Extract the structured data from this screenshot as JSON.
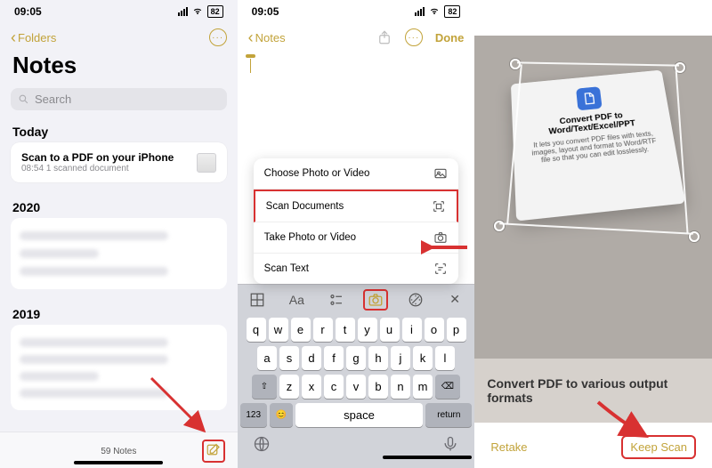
{
  "status": {
    "time": "09:05",
    "battery": "82"
  },
  "accent": "#c2a33a",
  "phone1": {
    "back_label": "Folders",
    "title": "Notes",
    "search_placeholder": "Search",
    "sections": {
      "today": "Today",
      "y2020": "2020",
      "y2019": "2019"
    },
    "note": {
      "title": "Scan to a PDF on your iPhone",
      "time": "08:54",
      "detail": "1 scanned document"
    },
    "footer_count": "59 Notes"
  },
  "phone2": {
    "back_label": "Notes",
    "done_label": "Done",
    "popup": [
      "Choose Photo or Video",
      "Scan Documents",
      "Take Photo or Video",
      "Scan Text"
    ],
    "toolbar": {
      "aa": "Aa"
    },
    "keyboard": {
      "row1": [
        "q",
        "w",
        "e",
        "r",
        "t",
        "y",
        "u",
        "i",
        "o",
        "p"
      ],
      "row2": [
        "a",
        "s",
        "d",
        "f",
        "g",
        "h",
        "j",
        "k",
        "l"
      ],
      "row3": [
        "z",
        "x",
        "c",
        "v",
        "b",
        "n",
        "m"
      ],
      "shift": "⇧",
      "backspace": "⌫",
      "num": "123",
      "emoji": "😊",
      "space": "space",
      "return": "return"
    }
  },
  "phone3": {
    "card_heading": "Convert PDF to Word/Text/Excel/PPT",
    "card_body": "It lets you convert PDF files with texts, images, layout and format to Word/RTF file so that you can edit losslessly.",
    "banner": "Convert PDF to various output formats",
    "retake": "Retake",
    "keep": "Keep Scan"
  }
}
